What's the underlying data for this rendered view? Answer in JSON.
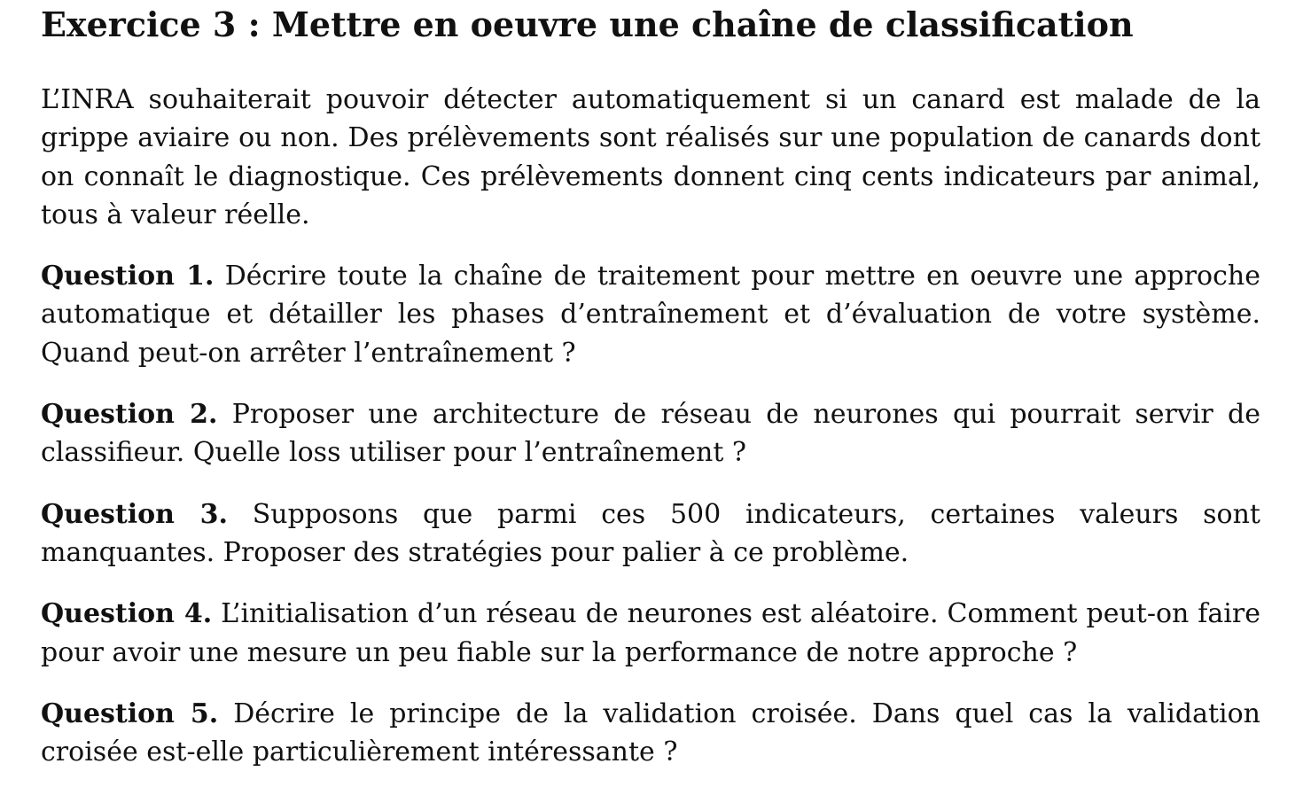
{
  "exercise": {
    "title": "Exercice 3 : Mettre en oeuvre une chaîne de classification",
    "intro": "L’INRA souhaiterait pouvoir détecter automatiquement si un canard est malade de la grippe aviaire ou non. Des prélèvements sont réalisés sur une population de canards dont on connaît le diagnostique. Ces prélèvements donnent cinq cents indicateurs par animal, tous à valeur réelle."
  },
  "questions": [
    {
      "label": "Question 1.",
      "text": "Décrire toute la chaîne de traitement pour mettre en oeuvre une approche automatique et détailler les phases d’entraînement et d’évaluation de votre système. Quand peut-on arrêter l’entraînement ?"
    },
    {
      "label": "Question 2.",
      "text": "Proposer une architecture de réseau de neurones qui pourrait servir de classifieur. Quelle loss utiliser pour l’entraînement ?"
    },
    {
      "label": "Question 3.",
      "text": "Supposons que parmi ces 500 indicateurs, certaines valeurs sont manquantes. Proposer des stratégies pour palier à ce problème."
    },
    {
      "label": "Question 4.",
      "text": "L’initialisation d’un réseau de neurones est aléatoire. Comment peut-on faire pour avoir une mesure un peu fiable sur la performance de notre approche ?"
    },
    {
      "label": "Question 5.",
      "text": "Décrire le principe de la validation croisée. Dans quel cas la validation croisée est-elle particulièrement intéressante ?"
    }
  ]
}
